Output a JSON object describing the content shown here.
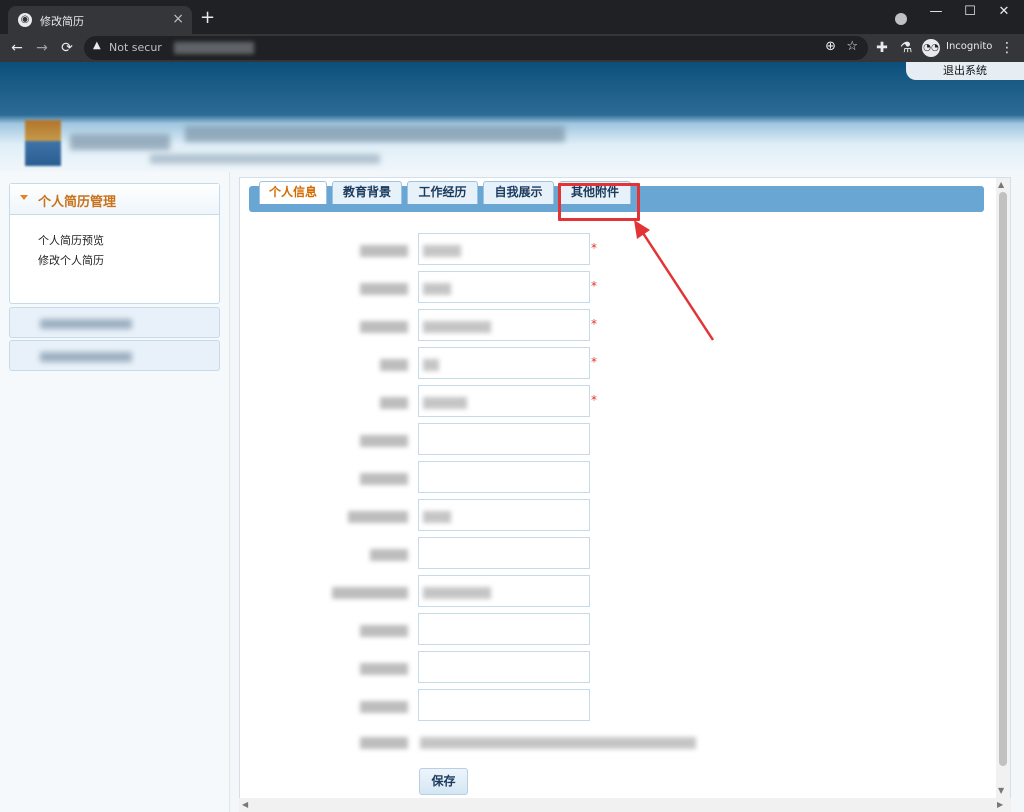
{
  "browser": {
    "tab_title": "修改简历",
    "tab_close": "×",
    "new_tab": "+",
    "minimize": "—",
    "maximize": "☐",
    "close": "✕",
    "back": "←",
    "forward": "→",
    "reload": "⟳",
    "url_prefix": "Not secur",
    "extensions": "✚",
    "labs": "⚗",
    "incognito_label": "Incognito",
    "menu": "⋮"
  },
  "header": {
    "logout": "退出系统"
  },
  "sidebar": {
    "panel_title": "个人简历管理",
    "links": [
      {
        "label": "个人简历预览"
      },
      {
        "label": "修改个人简历"
      }
    ]
  },
  "tabs": [
    {
      "label": "个人信息",
      "active": true
    },
    {
      "label": "教育背景"
    },
    {
      "label": "工作经历"
    },
    {
      "label": "自我展示"
    },
    {
      "label": "其他附件"
    }
  ],
  "form": {
    "required_mark": "*",
    "save_label": "保存"
  },
  "colors": {
    "accent": "#d46b00",
    "tab_bar": "#6aa6d3",
    "highlight": "#e23436"
  }
}
